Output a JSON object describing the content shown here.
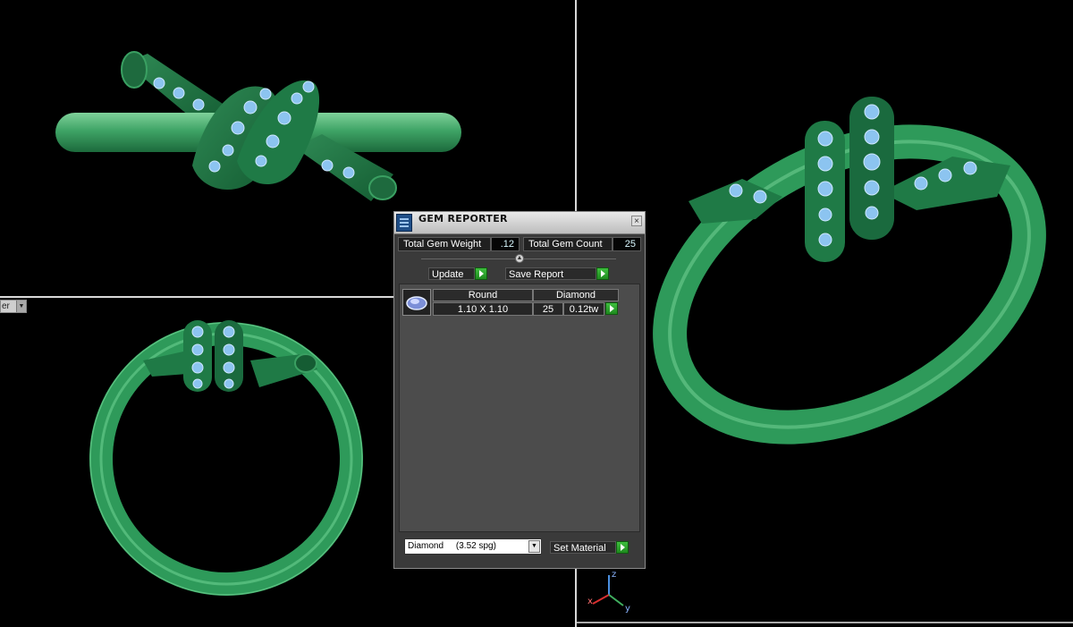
{
  "viewports": {
    "bottom_left_view_label": "er"
  },
  "gem_reporter": {
    "title": "GEM REPORTER",
    "close_glyph": "×",
    "total_gem_weight_label": "Total Gem Weight",
    "total_gem_weight_value": ".12",
    "total_gem_count_label": "Total Gem Count",
    "total_gem_count_value": "25",
    "update_label": "Update",
    "save_report_label": "Save Report",
    "table": {
      "headers": [
        "Round",
        "Diamond"
      ],
      "rows": [
        {
          "size": "1.10 X 1.10",
          "count": "25",
          "weight": "0.12tw"
        }
      ]
    },
    "material_select_value": "Diamond     (3.52 spg)",
    "set_material_label": "Set Material"
  },
  "axis_gizmo": {
    "x": "x",
    "y": "y",
    "z": "z"
  },
  "colors": {
    "ring_green": "#2e9a5a",
    "gem_blue": "#8cc4f0",
    "panel_bg": "#3a3a3a"
  }
}
